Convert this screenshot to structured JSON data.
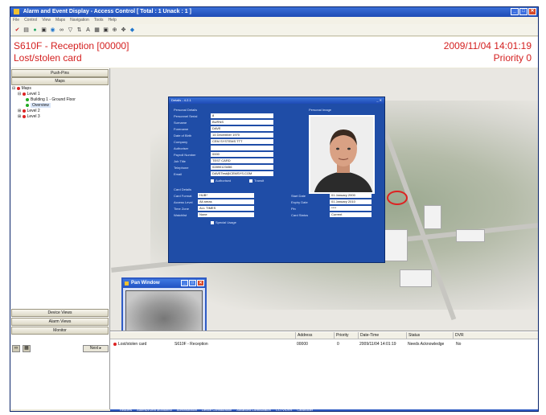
{
  "window": {
    "title": "Alarm and Event Display - Access Control [ Total : 1  Unack : 1 ]",
    "controls": [
      "_",
      "□",
      "✕"
    ]
  },
  "menu": [
    "File",
    "Control",
    "View",
    "Maps",
    "Navigation",
    "Tools",
    "Help"
  ],
  "toolbar_icons": [
    "acknowledge-icon",
    "print-icon",
    "filter-icon",
    "lock-icon",
    "refresh-icon",
    "binoculars-icon",
    "funnel-icon",
    "sort-icon",
    "text-icon",
    "grid-icon",
    "view-icon",
    "zoom-icon",
    "pan-icon",
    "nav-icon"
  ],
  "status": {
    "title": "S610F - Reception [00000]",
    "subtitle": "Lost/stolen card",
    "datetime": "2009/11/04 14:01:19",
    "priority": "Priority 0"
  },
  "left": {
    "pushpins_label": "Push-Pins",
    "maps_label": "Maps",
    "tree": [
      {
        "label": "Maps",
        "level": 0,
        "status": "red"
      },
      {
        "label": "Level 1",
        "level": 1,
        "status": "red"
      },
      {
        "label": "Building 1 - Ground Floor",
        "level": 2,
        "status": "green"
      },
      {
        "label": "Overview",
        "level": 2,
        "status": "green",
        "selected": true
      },
      {
        "label": "Level 2",
        "level": 1,
        "status": "red"
      },
      {
        "label": "Level 3",
        "level": 1,
        "status": "red"
      }
    ],
    "device_views_label": "Device Views",
    "alarm_views_label": "Alarm Views",
    "monitor_label": "Monitor",
    "next_label": "Next"
  },
  "cardholder": {
    "title": "Details - 4.2.1",
    "personal_heading": "Personal Details",
    "image_heading": "Personal Image",
    "fields": [
      {
        "label": "Personnel Serial",
        "value": "8"
      },
      {
        "label": "Surname",
        "value": "BURNS"
      },
      {
        "label": "Forename",
        "value": "DAVE"
      },
      {
        "label": "Date of Birth",
        "value": "14 December 1970"
      },
      {
        "label": "Company",
        "value": "CEM SYSTEMS TTT"
      },
      {
        "label": "Authoriser",
        "value": ""
      },
      {
        "label": "Payroll Number",
        "value": "0000"
      },
      {
        "label": "Job Title",
        "value": "TEST CARD"
      },
      {
        "label": "Telephone",
        "value": "02890123456"
      },
      {
        "label": "Email",
        "value": "DAVETest@CEMSYS.COM"
      }
    ],
    "checkboxes": [
      "Authorised",
      "Transit"
    ],
    "card_heading": "Card Details",
    "card_left": [
      {
        "label": "Card Format",
        "value": "HUB*"
      },
      {
        "label": "Access Level",
        "value": "All areas"
      },
      {
        "label": "Time Zone",
        "value": "ALL TIMES"
      },
      {
        "label": "Watchlist",
        "value": "None"
      }
    ],
    "card_right": [
      {
        "label": "Start Date",
        "value": "01 January 2000"
      },
      {
        "label": "Expiry Date",
        "value": "01 January 2010"
      },
      {
        "label": "Pin",
        "value": "****"
      },
      {
        "label": "Card Status",
        "value": "Current"
      }
    ],
    "special_usage": "Special Usage"
  },
  "pan_window": {
    "title": "Pan Window"
  },
  "alarm_list": {
    "columns": [
      "Address",
      "Priority",
      "Date-Time",
      "Status",
      "DVR"
    ],
    "rows": [
      {
        "description": "Lost/stolen card",
        "source": "S610F - Reception",
        "address": "00000",
        "priority": "0",
        "datetime": "2009/11/04 14:01:19",
        "status": "Needs Acknowledge",
        "dvr": "No"
      }
    ]
  },
  "taskbar": [
    "Readers",
    "Alarms/Event Monitoring",
    "Administration",
    "Device Configuration",
    "Advanced Configuration",
    "CCTV/DVR",
    "Cardholder"
  ]
}
